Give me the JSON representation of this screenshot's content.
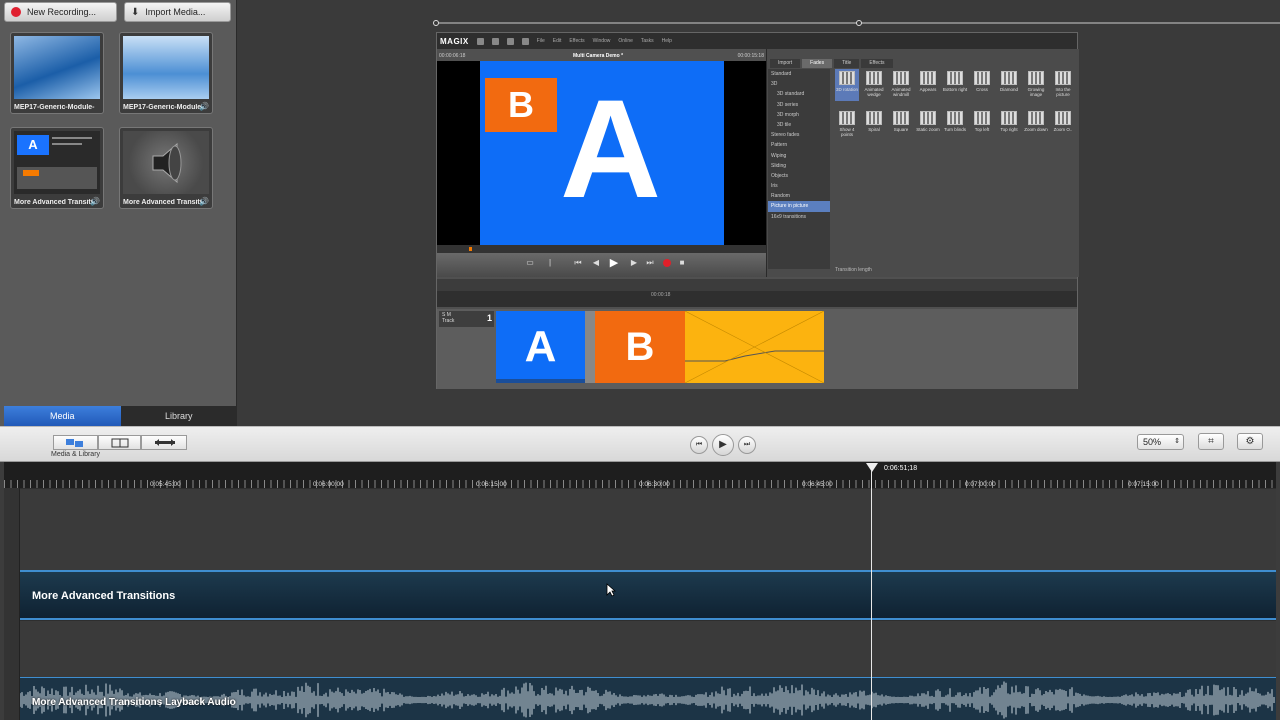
{
  "toolbar_top": {
    "new_recording": "New Recording...",
    "import_media": "Import Media..."
  },
  "media": [
    {
      "caption": "MEP17-Generic-Module-",
      "kind": "image"
    },
    {
      "caption": "MEP17-Generic-Module-",
      "kind": "image-audio"
    },
    {
      "caption": "More Advanced Transitio",
      "kind": "screen"
    },
    {
      "caption": "More Advanced Transitio",
      "kind": "audio"
    }
  ],
  "panel_tabs": {
    "media": "Media",
    "library": "Library"
  },
  "magix": {
    "logo": "MAGIX",
    "menus": [
      "File",
      "Edit",
      "Effects",
      "Window",
      "Online",
      "Tasks",
      "Help"
    ],
    "monitor_time_left": "00:00:06:18",
    "monitor_title": "Multi Camera Demo *",
    "monitor_time_right": "00:00:15:18",
    "preview_A": "A",
    "preview_B": "B",
    "fx_tabs": [
      "Import",
      "Fades",
      "Title",
      "Effects"
    ],
    "fx_categories": [
      {
        "label": "Standard",
        "indent": false
      },
      {
        "label": "3D",
        "indent": false
      },
      {
        "label": "3D standard",
        "indent": true
      },
      {
        "label": "3D series",
        "indent": true
      },
      {
        "label": "3D morph",
        "indent": true
      },
      {
        "label": "3D tile",
        "indent": true
      },
      {
        "label": "Stereo fades",
        "indent": false
      },
      {
        "label": "Pattern",
        "indent": false
      },
      {
        "label": "Wiping",
        "indent": false
      },
      {
        "label": "Sliding",
        "indent": false
      },
      {
        "label": "Objects",
        "indent": false
      },
      {
        "label": "Iris",
        "indent": false
      },
      {
        "label": "Random",
        "indent": false
      },
      {
        "label": "Picture in picture",
        "indent": false,
        "selected": true
      },
      {
        "label": "16x9 transitions",
        "indent": false
      }
    ],
    "fx_tiles_row1": [
      "3D rotation",
      "Animated wedge",
      "Animated windmill",
      "Appears",
      "Bottom right",
      "Cross",
      "Diamond",
      "Growing image",
      "Into the picture"
    ],
    "fx_tiles_row2": [
      "Show 4 points",
      "Spiral",
      "Square",
      "Static zoom",
      "Turn blinds",
      "Top left",
      "Top right",
      "Zoom down",
      "Zoom O.."
    ],
    "fx_length_label": "Transition length",
    "ruler_mark": "00:00:18",
    "track_label": "S M",
    "track_name": "Track",
    "track_number": "1",
    "clip_A": "A",
    "clip_B": "B"
  },
  "toolbar": {
    "media_library_label": "Media & Library",
    "zoom_value": "50%"
  },
  "timeline": {
    "times": [
      {
        "label": "0:05:45:00"
      },
      {
        "label": "0:06:00:00"
      },
      {
        "label": "0:06:15:00"
      },
      {
        "label": "0:06:30:00"
      },
      {
        "label": "0:06:45:00"
      },
      {
        "label": "0:07:00:00"
      },
      {
        "label": "0:07:15:00"
      }
    ],
    "playhead": "0:06:51;18",
    "video_clip": "More Advanced Transitions",
    "audio_clip": "More Advanced Transitions Layback Audio"
  }
}
